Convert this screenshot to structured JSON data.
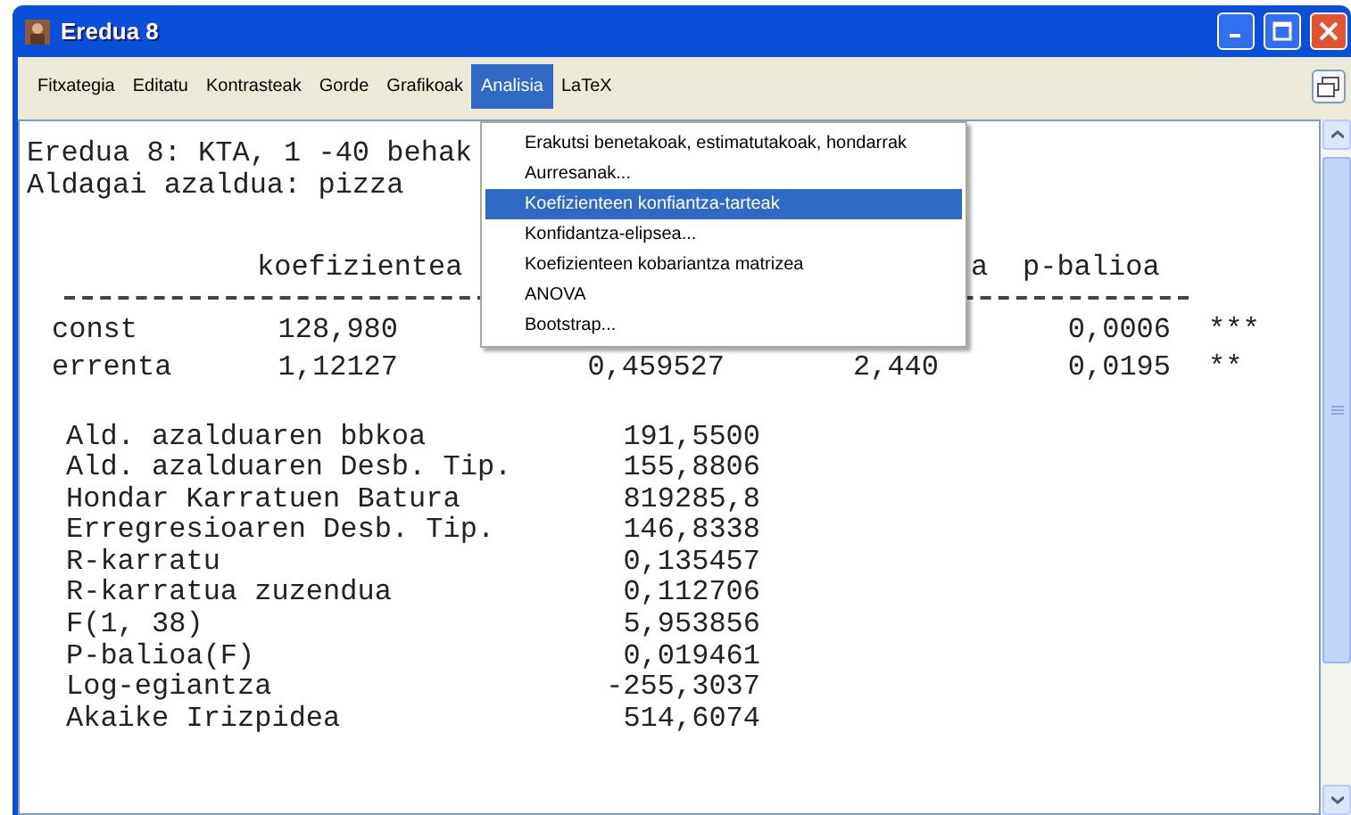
{
  "window": {
    "title": "Eredua 8"
  },
  "menu_bar": [
    {
      "label": "Fitxategia",
      "selected": false
    },
    {
      "label": "Editatu",
      "selected": false
    },
    {
      "label": "Kontrasteak",
      "selected": false
    },
    {
      "label": "Gorde",
      "selected": false
    },
    {
      "label": "Grafikoak",
      "selected": false
    },
    {
      "label": "Analisia",
      "selected": true
    },
    {
      "label": "LaTeX",
      "selected": false
    }
  ],
  "open_menu": {
    "items": [
      {
        "label": "Erakutsi benetakoak, estimatutakoak, hondarrak",
        "selected": false
      },
      {
        "label": "Aurresanak...",
        "selected": false
      },
      {
        "label": "Koefizienteen konfiantza-tarteak",
        "selected": true
      },
      {
        "label": "Konfidantza-elipsea...",
        "selected": false
      },
      {
        "label": "Koefizienteen kobariantza matrizea",
        "selected": false
      },
      {
        "label": "ANOVA",
        "selected": false
      },
      {
        "label": "Bootstrap...",
        "selected": false
      }
    ]
  },
  "output": {
    "header_lines": [
      "Eredua 8: KTA, 1 -40 behak",
      "Aldagai azaldua: pizza"
    ],
    "coef_header": [
      "koefizientea",
      "a",
      "p-balioa"
    ],
    "coef_rows": [
      {
        "name": "const",
        "coefficient": "128,980",
        "p_value": "0,0006",
        "stars": "***"
      },
      {
        "name": "errenta",
        "coefficient": "1,12127",
        "std_error": "0,459527",
        "t_ratio": "2,440",
        "p_value": "0,0195",
        "stars": "**"
      }
    ],
    "stats": [
      {
        "label": "Ald. azalduaren bbkoa",
        "value": "191,5500"
      },
      {
        "label": "Ald. azalduaren Desb. Tip.",
        "value": "155,8806"
      },
      {
        "label": "Hondar Karratuen Batura",
        "value": "819285,8"
      },
      {
        "label": "Erregresioaren Desb. Tip.",
        "value": "146,8338"
      },
      {
        "label": "R-karratu",
        "value": "0,135457"
      },
      {
        "label": "R-karratua zuzendua",
        "value": "0,112706"
      },
      {
        "label": "F(1, 38)",
        "value": "5,953856"
      },
      {
        "label": "P-balioa(F)",
        "value": "0,019461"
      },
      {
        "label": "Log-egiantza",
        "value": "-255,3037"
      },
      {
        "label": "Akaike Irizpidea",
        "value": "514,6074"
      }
    ]
  }
}
